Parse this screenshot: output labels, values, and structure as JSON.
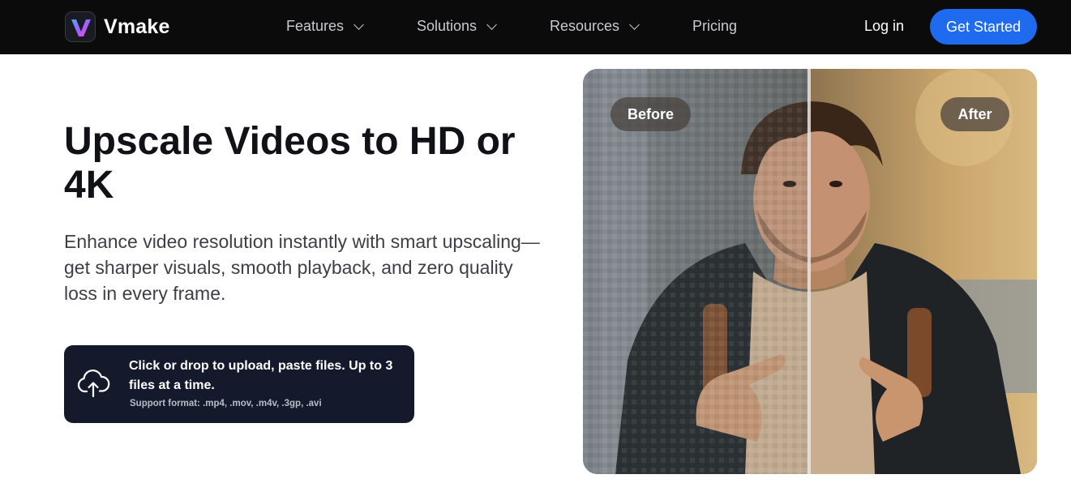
{
  "header": {
    "brand": "Vmake",
    "nav": [
      {
        "label": "Features",
        "dropdown": true
      },
      {
        "label": "Solutions",
        "dropdown": true
      },
      {
        "label": "Resources",
        "dropdown": true
      },
      {
        "label": "Pricing",
        "dropdown": false
      }
    ],
    "login_label": "Log in",
    "cta_label": "Get Started"
  },
  "hero": {
    "headline": "Upscale Videos to HD or 4K",
    "description": "Enhance video resolution instantly with smart upscaling—get sharper visuals, smooth playback, and zero quality loss in every frame."
  },
  "upload": {
    "main_text": "Click or drop to upload, paste files. Up to 3 files at a time.",
    "formats_text": "Support format: .mp4, .mov, .m4v, .3gp, .avi",
    "icon": "cloud-upload-icon"
  },
  "comparison": {
    "before_label": "Before",
    "after_label": "After"
  },
  "colors": {
    "header_bg": "#0b0b0c",
    "cta": "#1f6bf0",
    "upload_bg": "#141a2c",
    "headline": "#111118"
  }
}
